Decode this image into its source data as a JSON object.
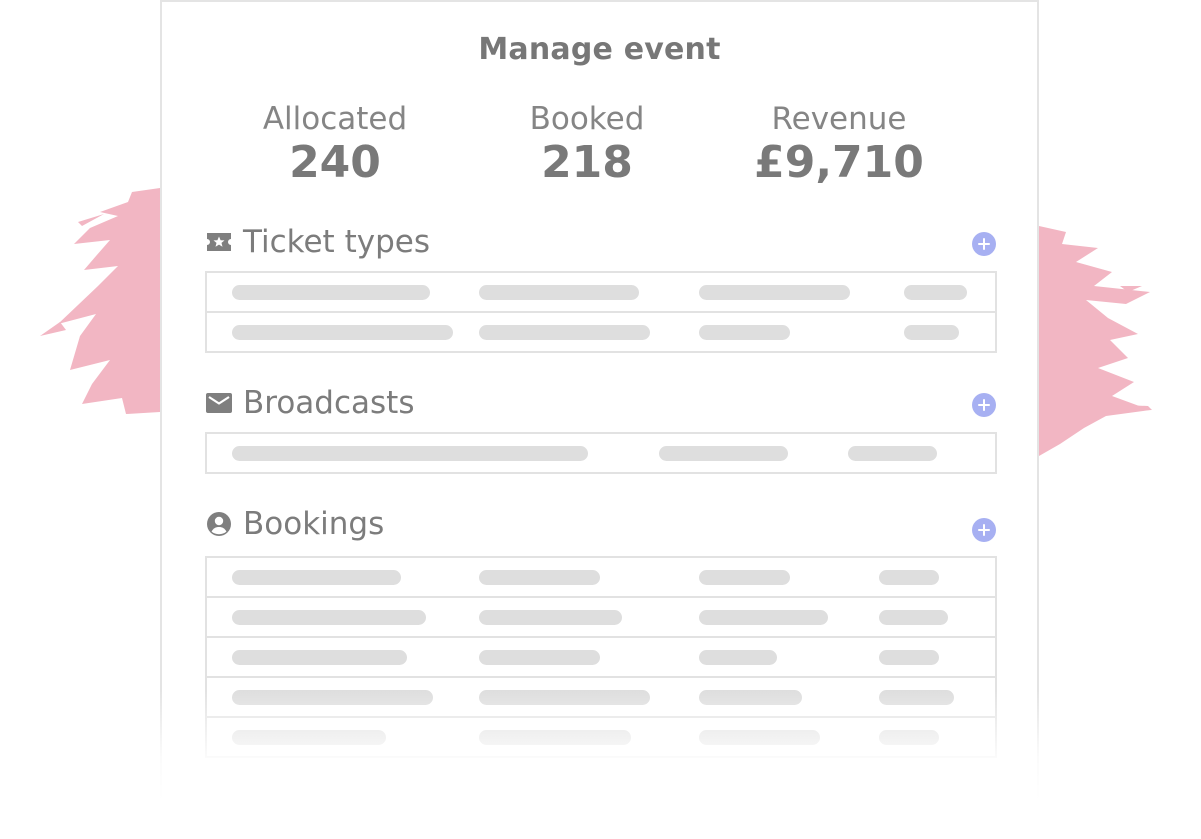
{
  "page": {
    "title": "Manage event"
  },
  "stats": {
    "allocated": {
      "label": "Allocated",
      "value": "240"
    },
    "booked": {
      "label": "Booked",
      "value": "218"
    },
    "revenue": {
      "label": "Revenue",
      "value": "£9,710"
    }
  },
  "sections": {
    "ticket_types": {
      "title": "Ticket types",
      "icon": "ticket-icon"
    },
    "broadcasts": {
      "title": "Broadcasts",
      "icon": "envelope-icon"
    },
    "bookings": {
      "title": "Bookings",
      "icon": "account-circle-icon"
    }
  },
  "colors": {
    "accent_add": "#a7b0f2",
    "splash": "#f2b6c3",
    "placeholder_bar": "#dedede",
    "text": "#7c7c7c"
  }
}
